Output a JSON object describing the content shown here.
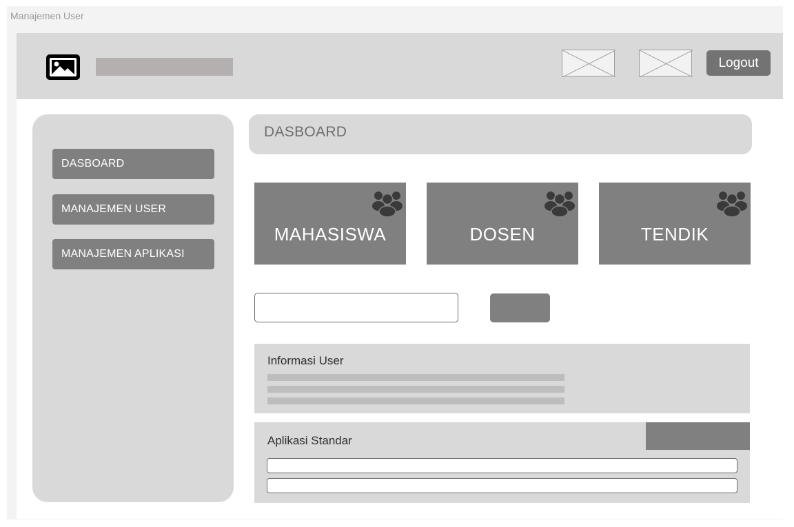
{
  "window": {
    "title": "Manajemen User"
  },
  "header": {
    "logo_icon": "image-icon",
    "logout_label": "Logout"
  },
  "sidebar": {
    "items": [
      {
        "label": "DASBOARD"
      },
      {
        "label": "MANAJEMEN USER"
      },
      {
        "label": "MANAJEMEN APLIKASI"
      }
    ]
  },
  "main": {
    "page_title": "DASBOARD",
    "cards": [
      {
        "label": "MAHASISWA",
        "icon": "users-icon"
      },
      {
        "label": "DOSEN",
        "icon": "users-icon"
      },
      {
        "label": "TENDIK",
        "icon": "users-icon"
      }
    ],
    "search": {
      "value": "",
      "placeholder": ""
    },
    "info_panel": {
      "title": "Informasi User"
    },
    "apps_panel": {
      "title": "Aplikasi Standar"
    }
  },
  "colors": {
    "header_bg": "#d9d9d9",
    "button_gray": "#808080",
    "logout_bg": "#737373",
    "frame_bg": "#f3f3f3"
  }
}
